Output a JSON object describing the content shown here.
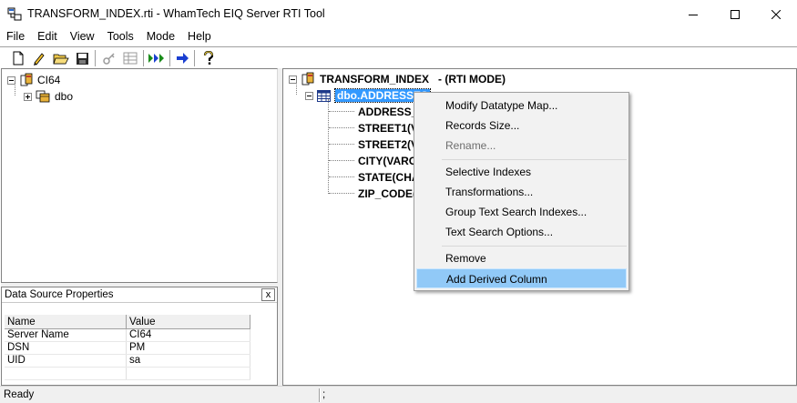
{
  "window": {
    "title": "TRANSFORM_INDEX.rti - WhamTech EIQ Server RTI Tool",
    "minimize_glyph": "—",
    "maximize_glyph": "☐",
    "close_glyph": "✕"
  },
  "menu": [
    "File",
    "Edit",
    "View",
    "Tools",
    "Mode",
    "Help"
  ],
  "toolbar": {
    "icons": [
      "new-file-icon",
      "pencil-icon",
      "open-folder-icon",
      "save-disk-icon",
      "key-icon",
      "grid-icon",
      "run-arrows-icon",
      "next-arrow-icon",
      "help-icon"
    ]
  },
  "left_tree": {
    "root": "CI64",
    "child": "dbo"
  },
  "right_tree": {
    "root": "TRANSFORM_INDEX",
    "mode": "- (RTI MODE)",
    "table": "dbo.ADDRESSES",
    "columns": [
      "ADDRESS_I",
      "STREET1(V.",
      "STREET2(V.",
      "CITY(VARC",
      "STATE(CHA",
      "ZIP_CODE(V"
    ]
  },
  "properties": {
    "title": "Data Source Properties",
    "close": "x",
    "headers": [
      "Name",
      "Value"
    ],
    "rows": [
      [
        "Server Name",
        "CI64"
      ],
      [
        "DSN",
        "PM"
      ],
      [
        "UID",
        "sa"
      ]
    ]
  },
  "context_menu": {
    "groups": [
      [
        {
          "label": "Modify Datatype Map...",
          "disabled": false
        },
        {
          "label": "Records Size...",
          "disabled": false
        },
        {
          "label": "Rename...",
          "disabled": true
        }
      ],
      [
        {
          "label": "Selective Indexes",
          "disabled": false
        },
        {
          "label": "Transformations...",
          "disabled": false
        },
        {
          "label": "Group Text Search Indexes...",
          "disabled": false
        },
        {
          "label": "Text Search Options...",
          "disabled": false
        }
      ],
      [
        {
          "label": "Remove",
          "disabled": false
        },
        {
          "label": "Add Derived Column",
          "disabled": false,
          "highlighted": true
        }
      ]
    ]
  },
  "status": {
    "left": "Ready",
    "right": ";"
  },
  "colors": {
    "selection": "#3399ff",
    "menu_hover": "#91c9f7",
    "menu_bg": "#f2f2f2"
  }
}
